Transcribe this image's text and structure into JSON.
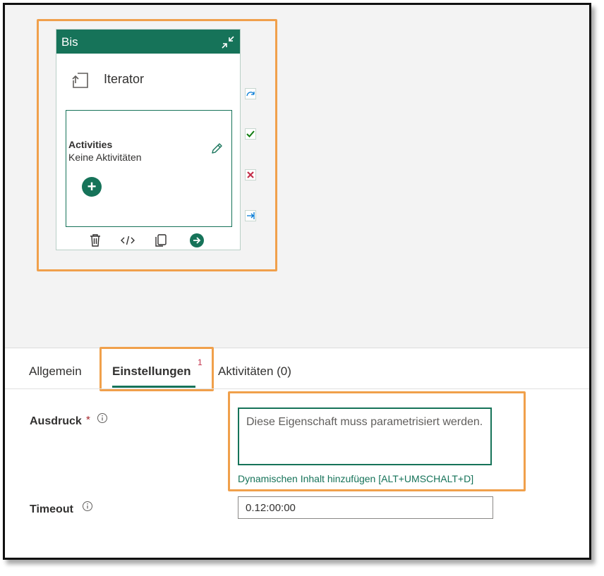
{
  "activity_card": {
    "title": "Bis",
    "type_label": "Iterator",
    "activities_title": "Activities",
    "activities_empty": "Keine Aktivitäten",
    "icons": {
      "collapse": "collapse-icon",
      "iterator": "iterator-icon",
      "edit": "pencil-icon",
      "add": "plus-icon",
      "delete": "trash-icon",
      "code": "code-icon",
      "copy": "copy-icon",
      "navigate": "arrow-right-circle-icon"
    },
    "side_ports": [
      "skip-arrow-icon",
      "success-check-icon",
      "failure-x-icon",
      "completion-arrow-icon"
    ]
  },
  "tabs": [
    {
      "label": "Allgemein"
    },
    {
      "label": "Einstellungen",
      "badge": "1",
      "active": true
    },
    {
      "label": "Aktivitäten (0)"
    }
  ],
  "form": {
    "expression": {
      "label": "Ausdruck",
      "required_marker": "*",
      "placeholder": "Diese Eigenschaft muss parametrisiert werden.",
      "value": "",
      "dynamic_link": "Dynamischen Inhalt hinzufügen [ALT+UMSCHALT+D]"
    },
    "timeout": {
      "label": "Timeout",
      "value": "0.12:00:00"
    }
  },
  "colors": {
    "accent": "#167359",
    "highlight": "#f0a04b",
    "success": "#107c10",
    "failure": "#c4314b",
    "link": "#0078d4"
  }
}
